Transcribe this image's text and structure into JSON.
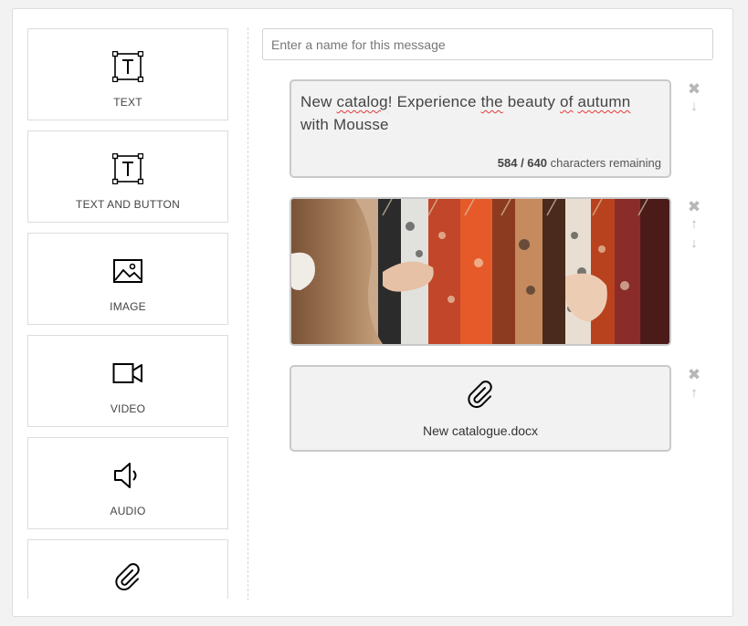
{
  "palette": {
    "items": [
      {
        "label": "TEXT",
        "icon": "text-icon"
      },
      {
        "label": "TEXT AND BUTTON",
        "icon": "text-icon"
      },
      {
        "label": "IMAGE",
        "icon": "image-icon"
      },
      {
        "label": "VIDEO",
        "icon": "video-icon"
      },
      {
        "label": "AUDIO",
        "icon": "audio-icon"
      },
      {
        "label": "",
        "icon": "paperclip-icon"
      }
    ]
  },
  "message": {
    "name_placeholder": "Enter a name for this message",
    "name_value": ""
  },
  "blocks": {
    "text": {
      "words": [
        "New",
        "catalog",
        "! Experience",
        "the",
        "beauty",
        "of",
        "autumn",
        "with Mousse"
      ],
      "counter_value": "584 / 640",
      "counter_suffix": "characters remaining"
    },
    "image": {
      "icon": "clothing-rack-photo"
    },
    "file": {
      "name": "New catalogue.docx",
      "icon": "paperclip-icon"
    }
  },
  "controls": {
    "remove_glyph": "✖",
    "up_glyph": "↑",
    "down_glyph": "↓"
  },
  "colors": {
    "panel_bg": "#ffffff",
    "page_bg": "#f2f2f2",
    "block_bg": "#f2f2f2",
    "block_border": "#c9c9c9",
    "control_gray": "#b7b7b7",
    "spell_error": "#e23b3b"
  }
}
